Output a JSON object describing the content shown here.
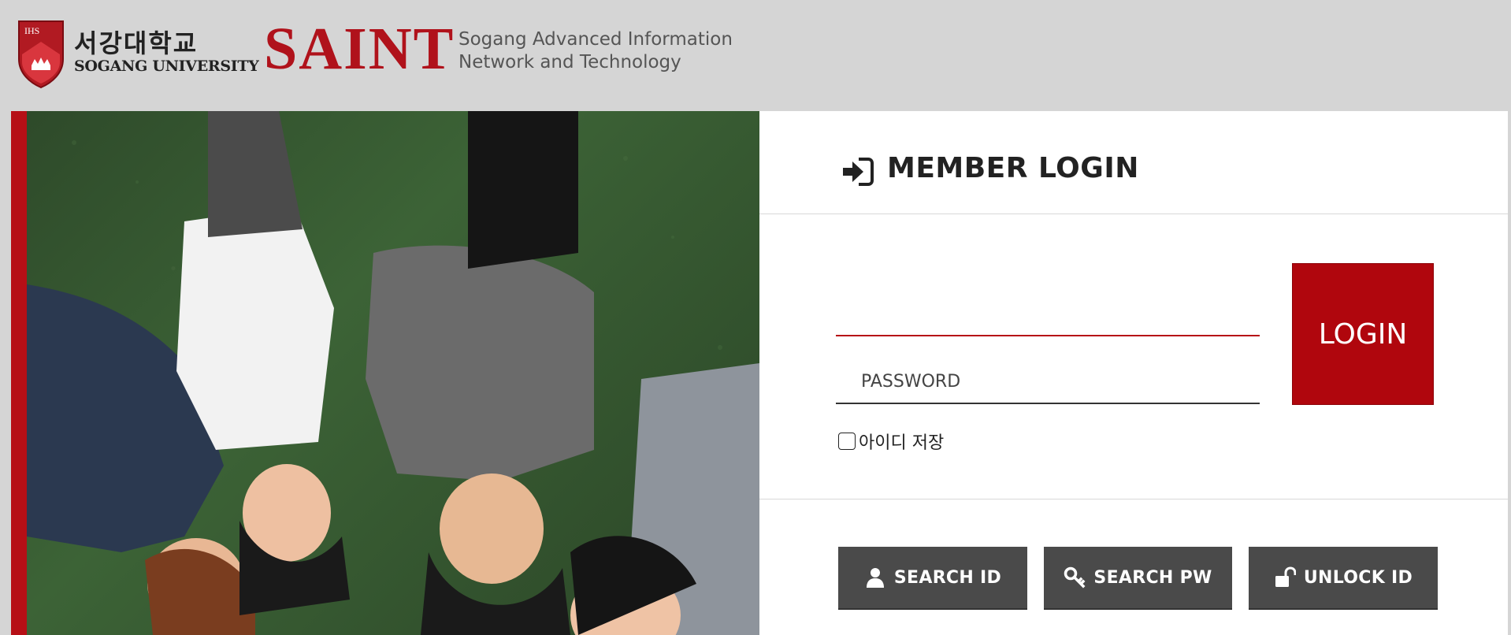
{
  "header": {
    "university_ko": "서강대학교",
    "university_en": "SOGANG UNIVERSITY",
    "crest_text": "IHS",
    "brand": "SAINT",
    "tagline_line1": "Sogang Advanced Information",
    "tagline_line2": "Network and Technology"
  },
  "login": {
    "title": "MEMBER LOGIN",
    "id_value": "",
    "password_placeholder": "PASSWORD",
    "login_button": "LOGIN",
    "remember_label": "아이디 저장",
    "remember_checked": false
  },
  "actions": [
    {
      "label": "SEARCH ID",
      "icon": "user-icon"
    },
    {
      "label": "SEARCH PW",
      "icon": "key-icon"
    },
    {
      "label": "UNLOCK ID",
      "icon": "unlock-icon"
    }
  ],
  "colors": {
    "brand_red": "#b0060d",
    "header_bg": "#d5d5d5",
    "button_gray": "#4a4a4a"
  }
}
